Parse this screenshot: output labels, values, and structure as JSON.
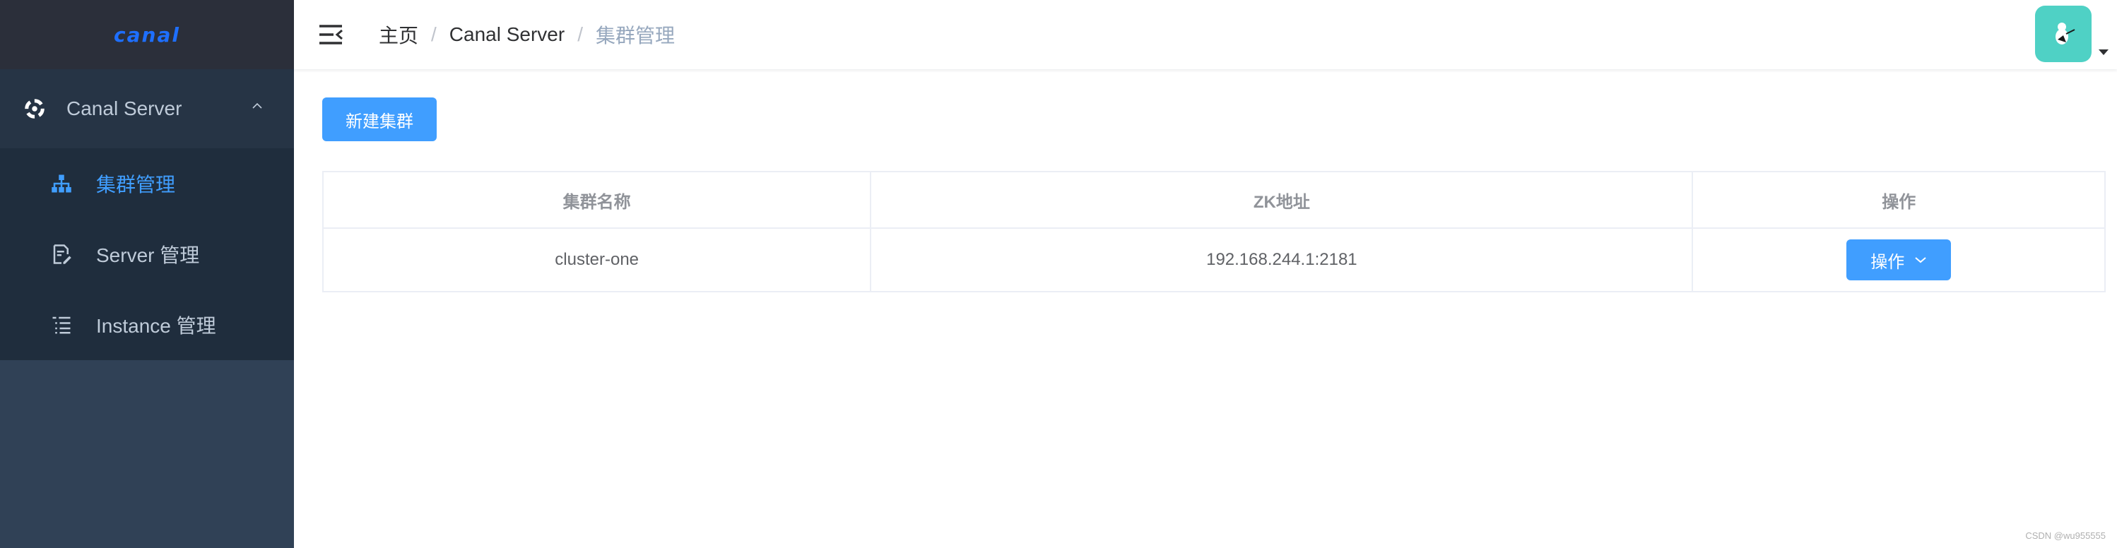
{
  "sidebar": {
    "logo": "canal",
    "submenu": {
      "label": "Canal Server",
      "icon": "gear-icon"
    },
    "items": [
      {
        "label": "集群管理",
        "icon": "sitemap-icon",
        "active": true
      },
      {
        "label": "Server 管理",
        "icon": "document-edit-icon",
        "active": false
      },
      {
        "label": "Instance 管理",
        "icon": "list-icon",
        "active": false
      }
    ],
    "colors": {
      "bg": "#304156",
      "active": "#409eff",
      "text": "#bfcbd9"
    }
  },
  "header": {
    "breadcrumb": [
      "主页",
      "Canal Server",
      "集群管理"
    ],
    "separator": "/"
  },
  "main": {
    "new_button": "新建集群",
    "table": {
      "headers": [
        "集群名称",
        "ZK地址",
        "操作"
      ],
      "rows": [
        {
          "name": "cluster-one",
          "zk": "192.168.244.1:2181",
          "action": "操作"
        }
      ]
    }
  },
  "watermark": "CSDN @wu955555"
}
